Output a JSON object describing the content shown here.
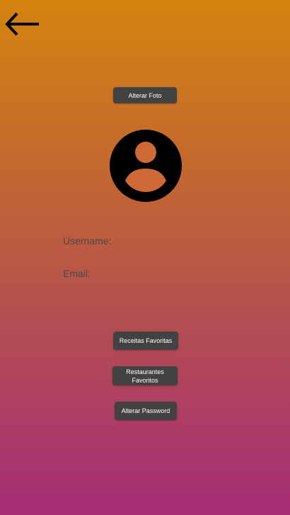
{
  "header": {
    "back_icon": "arrow-left-icon"
  },
  "profile": {
    "change_photo_label": "Alterar Foto",
    "avatar_icon": "account-circle-icon",
    "username_label": "Username:",
    "email_label": "Email:"
  },
  "actions": {
    "favorite_recipes_label": "Receitas Favoritas",
    "favorite_restaurants_label": "Restaurantes Favoritos",
    "change_password_label": "Alterar Password"
  },
  "colors": {
    "gradient_top": "#d4840f",
    "gradient_bottom": "#a52d76",
    "button_bg": "#424242",
    "button_text": "#ffffff",
    "label_text": "#4a4a4a"
  }
}
